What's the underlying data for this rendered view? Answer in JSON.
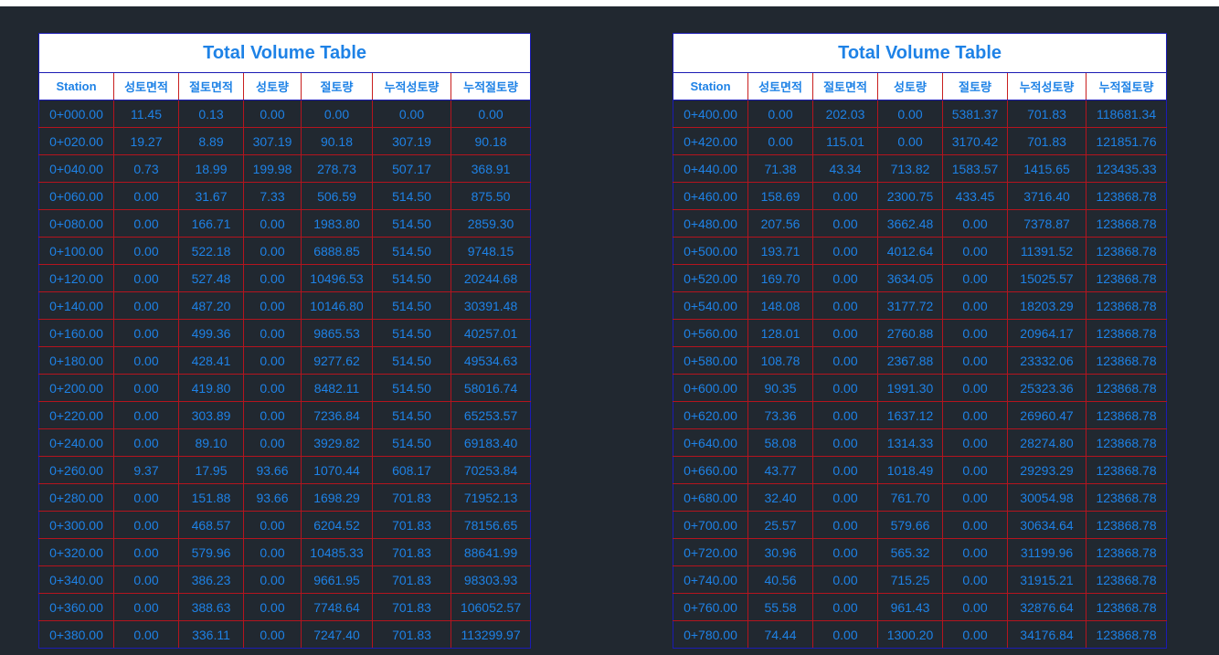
{
  "colors": {
    "background": "#212830",
    "text": "#1e82e6",
    "grid_line": "#b4141e",
    "outer_border": "#1b1bb4",
    "header_fill": "#ffffff"
  },
  "tables": [
    {
      "title": "Total Volume Table",
      "headers": [
        "Station",
        "성토면적",
        "절토면적",
        "성토량",
        "절토량",
        "누적성토량",
        "누적절토량"
      ],
      "rows": [
        [
          "0+000.00",
          "11.45",
          "0.13",
          "0.00",
          "0.00",
          "0.00",
          "0.00"
        ],
        [
          "0+020.00",
          "19.27",
          "8.89",
          "307.19",
          "90.18",
          "307.19",
          "90.18"
        ],
        [
          "0+040.00",
          "0.73",
          "18.99",
          "199.98",
          "278.73",
          "507.17",
          "368.91"
        ],
        [
          "0+060.00",
          "0.00",
          "31.67",
          "7.33",
          "506.59",
          "514.50",
          "875.50"
        ],
        [
          "0+080.00",
          "0.00",
          "166.71",
          "0.00",
          "1983.80",
          "514.50",
          "2859.30"
        ],
        [
          "0+100.00",
          "0.00",
          "522.18",
          "0.00",
          "6888.85",
          "514.50",
          "9748.15"
        ],
        [
          "0+120.00",
          "0.00",
          "527.48",
          "0.00",
          "10496.53",
          "514.50",
          "20244.68"
        ],
        [
          "0+140.00",
          "0.00",
          "487.20",
          "0.00",
          "10146.80",
          "514.50",
          "30391.48"
        ],
        [
          "0+160.00",
          "0.00",
          "499.36",
          "0.00",
          "9865.53",
          "514.50",
          "40257.01"
        ],
        [
          "0+180.00",
          "0.00",
          "428.41",
          "0.00",
          "9277.62",
          "514.50",
          "49534.63"
        ],
        [
          "0+200.00",
          "0.00",
          "419.80",
          "0.00",
          "8482.11",
          "514.50",
          "58016.74"
        ],
        [
          "0+220.00",
          "0.00",
          "303.89",
          "0.00",
          "7236.84",
          "514.50",
          "65253.57"
        ],
        [
          "0+240.00",
          "0.00",
          "89.10",
          "0.00",
          "3929.82",
          "514.50",
          "69183.40"
        ],
        [
          "0+260.00",
          "9.37",
          "17.95",
          "93.66",
          "1070.44",
          "608.17",
          "70253.84"
        ],
        [
          "0+280.00",
          "0.00",
          "151.88",
          "93.66",
          "1698.29",
          "701.83",
          "71952.13"
        ],
        [
          "0+300.00",
          "0.00",
          "468.57",
          "0.00",
          "6204.52",
          "701.83",
          "78156.65"
        ],
        [
          "0+320.00",
          "0.00",
          "579.96",
          "0.00",
          "10485.33",
          "701.83",
          "88641.99"
        ],
        [
          "0+340.00",
          "0.00",
          "386.23",
          "0.00",
          "9661.95",
          "701.83",
          "98303.93"
        ],
        [
          "0+360.00",
          "0.00",
          "388.63",
          "0.00",
          "7748.64",
          "701.83",
          "106052.57"
        ],
        [
          "0+380.00",
          "0.00",
          "336.11",
          "0.00",
          "7247.40",
          "701.83",
          "113299.97"
        ]
      ]
    },
    {
      "title": "Total Volume Table",
      "headers": [
        "Station",
        "성토면적",
        "절토면적",
        "성토량",
        "절토량",
        "누적성토량",
        "누적절토량"
      ],
      "rows": [
        [
          "0+400.00",
          "0.00",
          "202.03",
          "0.00",
          "5381.37",
          "701.83",
          "118681.34"
        ],
        [
          "0+420.00",
          "0.00",
          "115.01",
          "0.00",
          "3170.42",
          "701.83",
          "121851.76"
        ],
        [
          "0+440.00",
          "71.38",
          "43.34",
          "713.82",
          "1583.57",
          "1415.65",
          "123435.33"
        ],
        [
          "0+460.00",
          "158.69",
          "0.00",
          "2300.75",
          "433.45",
          "3716.40",
          "123868.78"
        ],
        [
          "0+480.00",
          "207.56",
          "0.00",
          "3662.48",
          "0.00",
          "7378.87",
          "123868.78"
        ],
        [
          "0+500.00",
          "193.71",
          "0.00",
          "4012.64",
          "0.00",
          "11391.52",
          "123868.78"
        ],
        [
          "0+520.00",
          "169.70",
          "0.00",
          "3634.05",
          "0.00",
          "15025.57",
          "123868.78"
        ],
        [
          "0+540.00",
          "148.08",
          "0.00",
          "3177.72",
          "0.00",
          "18203.29",
          "123868.78"
        ],
        [
          "0+560.00",
          "128.01",
          "0.00",
          "2760.88",
          "0.00",
          "20964.17",
          "123868.78"
        ],
        [
          "0+580.00",
          "108.78",
          "0.00",
          "2367.88",
          "0.00",
          "23332.06",
          "123868.78"
        ],
        [
          "0+600.00",
          "90.35",
          "0.00",
          "1991.30",
          "0.00",
          "25323.36",
          "123868.78"
        ],
        [
          "0+620.00",
          "73.36",
          "0.00",
          "1637.12",
          "0.00",
          "26960.47",
          "123868.78"
        ],
        [
          "0+640.00",
          "58.08",
          "0.00",
          "1314.33",
          "0.00",
          "28274.80",
          "123868.78"
        ],
        [
          "0+660.00",
          "43.77",
          "0.00",
          "1018.49",
          "0.00",
          "29293.29",
          "123868.78"
        ],
        [
          "0+680.00",
          "32.40",
          "0.00",
          "761.70",
          "0.00",
          "30054.98",
          "123868.78"
        ],
        [
          "0+700.00",
          "25.57",
          "0.00",
          "579.66",
          "0.00",
          "30634.64",
          "123868.78"
        ],
        [
          "0+720.00",
          "30.96",
          "0.00",
          "565.32",
          "0.00",
          "31199.96",
          "123868.78"
        ],
        [
          "0+740.00",
          "40.56",
          "0.00",
          "715.25",
          "0.00",
          "31915.21",
          "123868.78"
        ],
        [
          "0+760.00",
          "55.58",
          "0.00",
          "961.43",
          "0.00",
          "32876.64",
          "123868.78"
        ],
        [
          "0+780.00",
          "74.44",
          "0.00",
          "1300.20",
          "0.00",
          "34176.84",
          "123868.78"
        ]
      ]
    }
  ]
}
